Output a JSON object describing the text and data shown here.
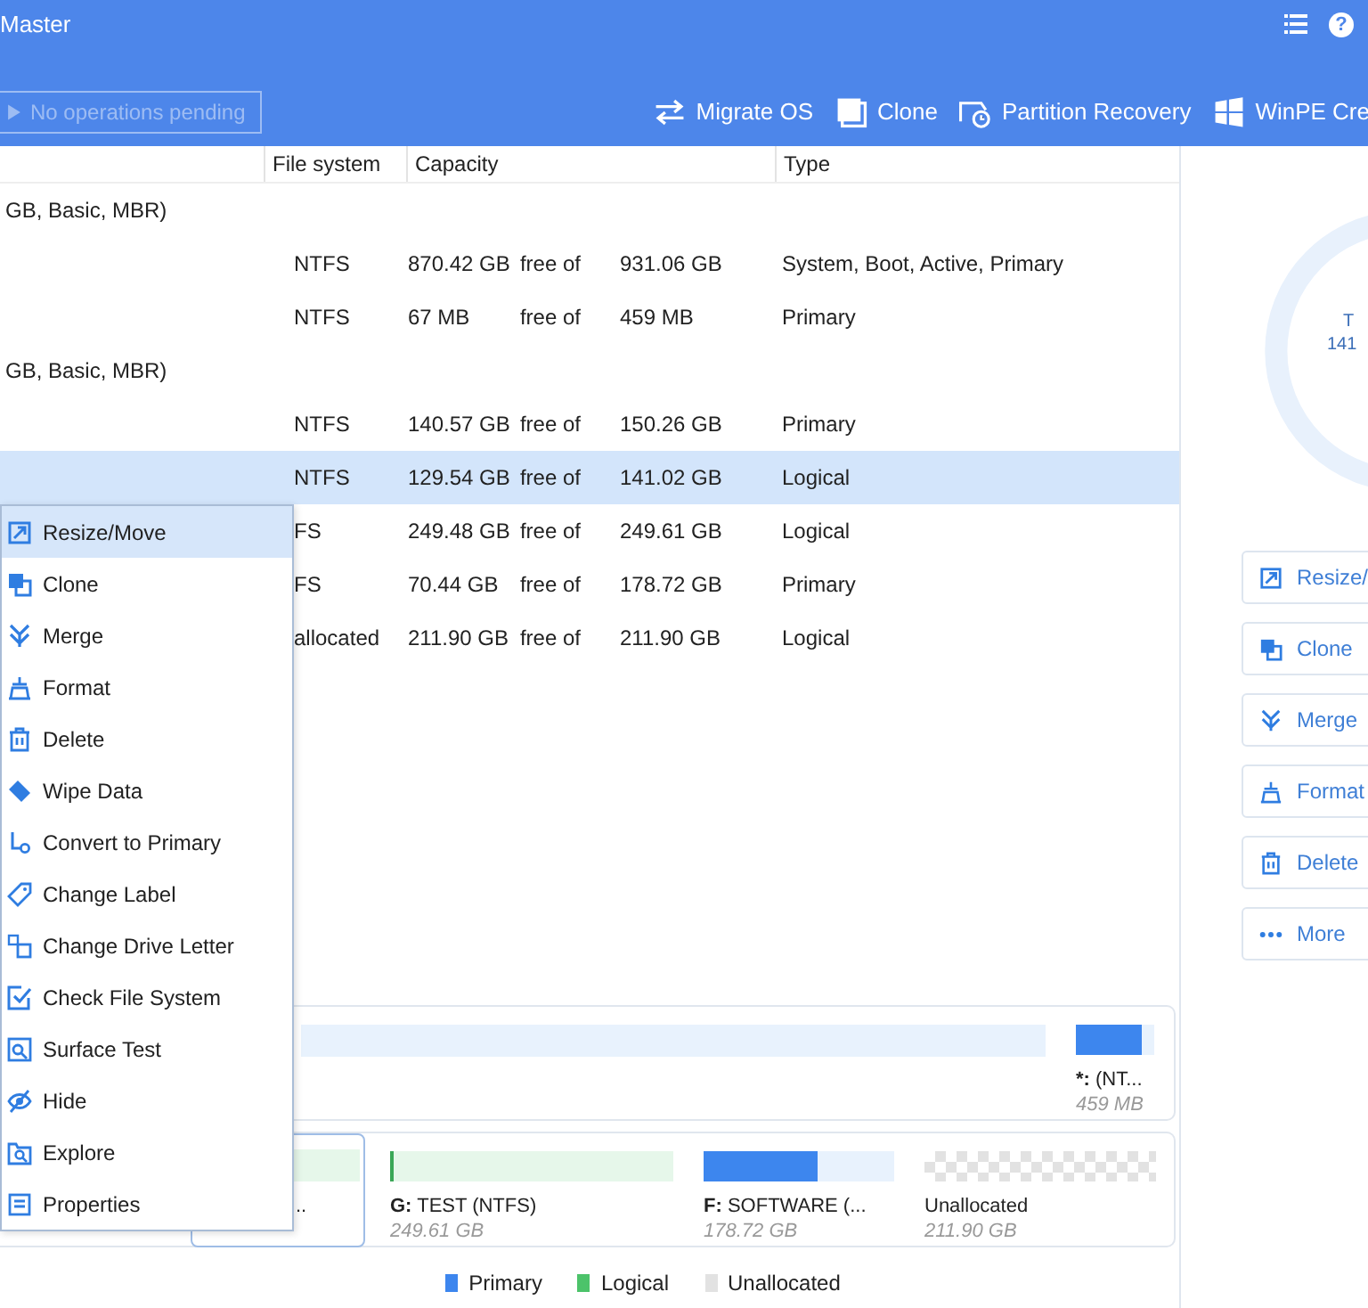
{
  "window": {
    "title": "Master",
    "help_glyph": "?"
  },
  "toolbar": {
    "pending": {
      "label": "No operations pending",
      "disabled": true
    },
    "tools": [
      {
        "label": "Migrate OS"
      },
      {
        "label": "Clone"
      },
      {
        "label": "Partition Recovery"
      },
      {
        "label": "WinPE Cre"
      }
    ]
  },
  "table": {
    "columns": [
      "File system",
      "Capacity",
      "Type"
    ],
    "rows": [
      {
        "kind": "disk",
        "label": "GB, Basic, MBR)"
      },
      {
        "kind": "partition",
        "file_system": "NTFS",
        "free": "870.42 GB",
        "free_of": "free of",
        "total": "931.06 GB",
        "type": "System, Boot, Active, Primary",
        "selected": false
      },
      {
        "kind": "partition",
        "file_system": "NTFS",
        "free": "67 MB",
        "free_of": "free of",
        "total": "459 MB",
        "type": "Primary",
        "selected": false
      },
      {
        "kind": "disk",
        "label": "GB, Basic, MBR)"
      },
      {
        "kind": "partition",
        "file_system": "NTFS",
        "free": "140.57 GB",
        "free_of": "free of",
        "total": "150.26 GB",
        "type": "Primary",
        "selected": false
      },
      {
        "kind": "partition",
        "file_system": "NTFS",
        "free": "129.54 GB",
        "free_of": "free of",
        "total": "141.02 GB",
        "type": "Logical",
        "selected": true
      },
      {
        "kind": "partition",
        "file_system": "FS",
        "free": "249.48 GB",
        "free_of": "free of",
        "total": "249.61 GB",
        "type": "Logical",
        "selected": false
      },
      {
        "kind": "partition",
        "file_system": "FS",
        "free": "70.44 GB",
        "free_of": "free of",
        "total": "178.72 GB",
        "type": "Primary",
        "selected": false
      },
      {
        "kind": "partition",
        "file_system": "allocated",
        "free": "211.90 GB",
        "free_of": "free of",
        "total": "211.90 GB",
        "type": "Logical",
        "selected": false
      }
    ]
  },
  "context_menu": {
    "items": [
      {
        "label": "Resize/Move",
        "selected": true
      },
      {
        "label": "Clone",
        "selected": false
      },
      {
        "label": "Merge",
        "selected": false
      },
      {
        "label": "Format",
        "selected": false
      },
      {
        "label": "Delete",
        "selected": false
      },
      {
        "label": "Wipe Data",
        "selected": false
      },
      {
        "label": "Convert to Primary",
        "selected": false
      },
      {
        "label": "Change Label",
        "selected": false
      },
      {
        "label": "Change Drive Letter",
        "selected": false
      },
      {
        "label": "Check File System",
        "selected": false
      },
      {
        "label": "Surface Test",
        "selected": false
      },
      {
        "label": "Hide",
        "selected": false
      },
      {
        "label": "Explore",
        "selected": false
      },
      {
        "label": "Properties",
        "selected": false
      }
    ]
  },
  "disk_map": [
    {
      "partitions": [
        {
          "kind": "primary",
          "selected": false
        },
        {
          "kind": "primary",
          "selected": false,
          "level": 0.85,
          "letter": "*:",
          "name": "(NT...",
          "size": "459 MB"
        }
      ]
    },
    {
      "partitions": [
        {
          "kind": "logical",
          "selected": true,
          "name": ".."
        },
        {
          "kind": "logical",
          "selected": false,
          "level": 0.01,
          "letter": "G:",
          "name": "TEST (NTFS)",
          "size": "249.61 GB"
        },
        {
          "kind": "primary",
          "selected": false,
          "level": 0.6,
          "letter": "F:",
          "name": "SOFTWARE (...",
          "size": "178.72 GB"
        },
        {
          "kind": "unallocated",
          "selected": false,
          "name": "Unallocated",
          "size": "211.90 GB"
        }
      ]
    }
  ],
  "legend": [
    {
      "label": "Primary",
      "color": "#3d86ee"
    },
    {
      "label": "Logical",
      "color": "#4cc36a"
    },
    {
      "label": "Unallocated",
      "color": "#e2e2e2"
    }
  ],
  "right_panel": {
    "donut_text": [
      "T",
      "141"
    ],
    "actions": [
      {
        "label": "Resize/"
      },
      {
        "label": "Clone"
      },
      {
        "label": "Merge"
      },
      {
        "label": "Format"
      },
      {
        "label": "Delete"
      },
      {
        "label": "More"
      }
    ]
  }
}
